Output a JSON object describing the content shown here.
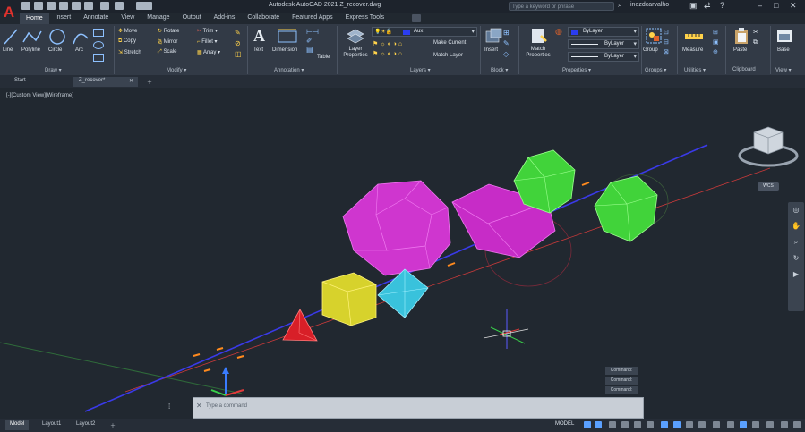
{
  "app": {
    "title": "Autodesk AutoCAD 2021   Z_recover.dwg",
    "search_placeholder": "Type a keyword or phrase",
    "user": "inezdcarvalho",
    "logo": "A"
  },
  "ribbon_tabs": [
    "Home",
    "Insert",
    "Annotate",
    "View",
    "Manage",
    "Output",
    "Add-ins",
    "Collaborate",
    "Featured Apps",
    "Express Tools"
  ],
  "draw": {
    "title": "Draw ▾",
    "line": "Line",
    "polyline": "Polyline",
    "circle": "Circle",
    "arc": "Arc"
  },
  "modify": {
    "title": "Modify ▾",
    "move": "Move",
    "rotate": "Rotate",
    "trim": "Trim ▾",
    "copy": "Copy",
    "mirror": "Mirror",
    "fillet": "Fillet ▾",
    "stretch": "Stretch",
    "scale": "Scale",
    "array": "Array ▾"
  },
  "annotation": {
    "title": "Annotation ▾",
    "text": "Text",
    "dimension": "Dimension",
    "table": "Table"
  },
  "layers": {
    "title": "Layers ▾",
    "layer_properties": "Layer Properties",
    "current_layer": "Aux",
    "make_current": "Make Current",
    "match_layer": "Match Layer"
  },
  "block": {
    "title": "Block ▾",
    "insert": "Insert"
  },
  "properties": {
    "title": "Properties ▾",
    "match_properties": "Match Properties",
    "bylayer1": "ByLayer",
    "bylayer2": "ByLayer",
    "bylayer3": "ByLayer"
  },
  "groups": {
    "title": "Groups ▾",
    "group": "Group"
  },
  "utilities": {
    "title": "Utilities ▾",
    "measure": "Measure"
  },
  "clipboard": {
    "title": "Clipboard",
    "paste": "Paste"
  },
  "view": {
    "title": "View ▾",
    "base": "Base"
  },
  "doc_tabs": [
    "Start",
    "Z_recover*"
  ],
  "viewport": {
    "label": "[-][Custom View][Wireframe]",
    "wcs": "WCS"
  },
  "command": {
    "placeholder": "Type a command",
    "history": [
      "Command:",
      "Command:",
      "Command:"
    ]
  },
  "layout_tabs": [
    "Model",
    "Layout1",
    "Layout2"
  ],
  "status": {
    "model": "MODEL"
  },
  "colors": {
    "accent": "#5aa0ff",
    "viewport_bg": "#212830",
    "dodecahedron": "#d63ad6",
    "icosahedron": "#44d63b",
    "cube": "#d9d52e",
    "octahedron": "#3fc9e0",
    "tetrahedron": "#e0222a"
  }
}
